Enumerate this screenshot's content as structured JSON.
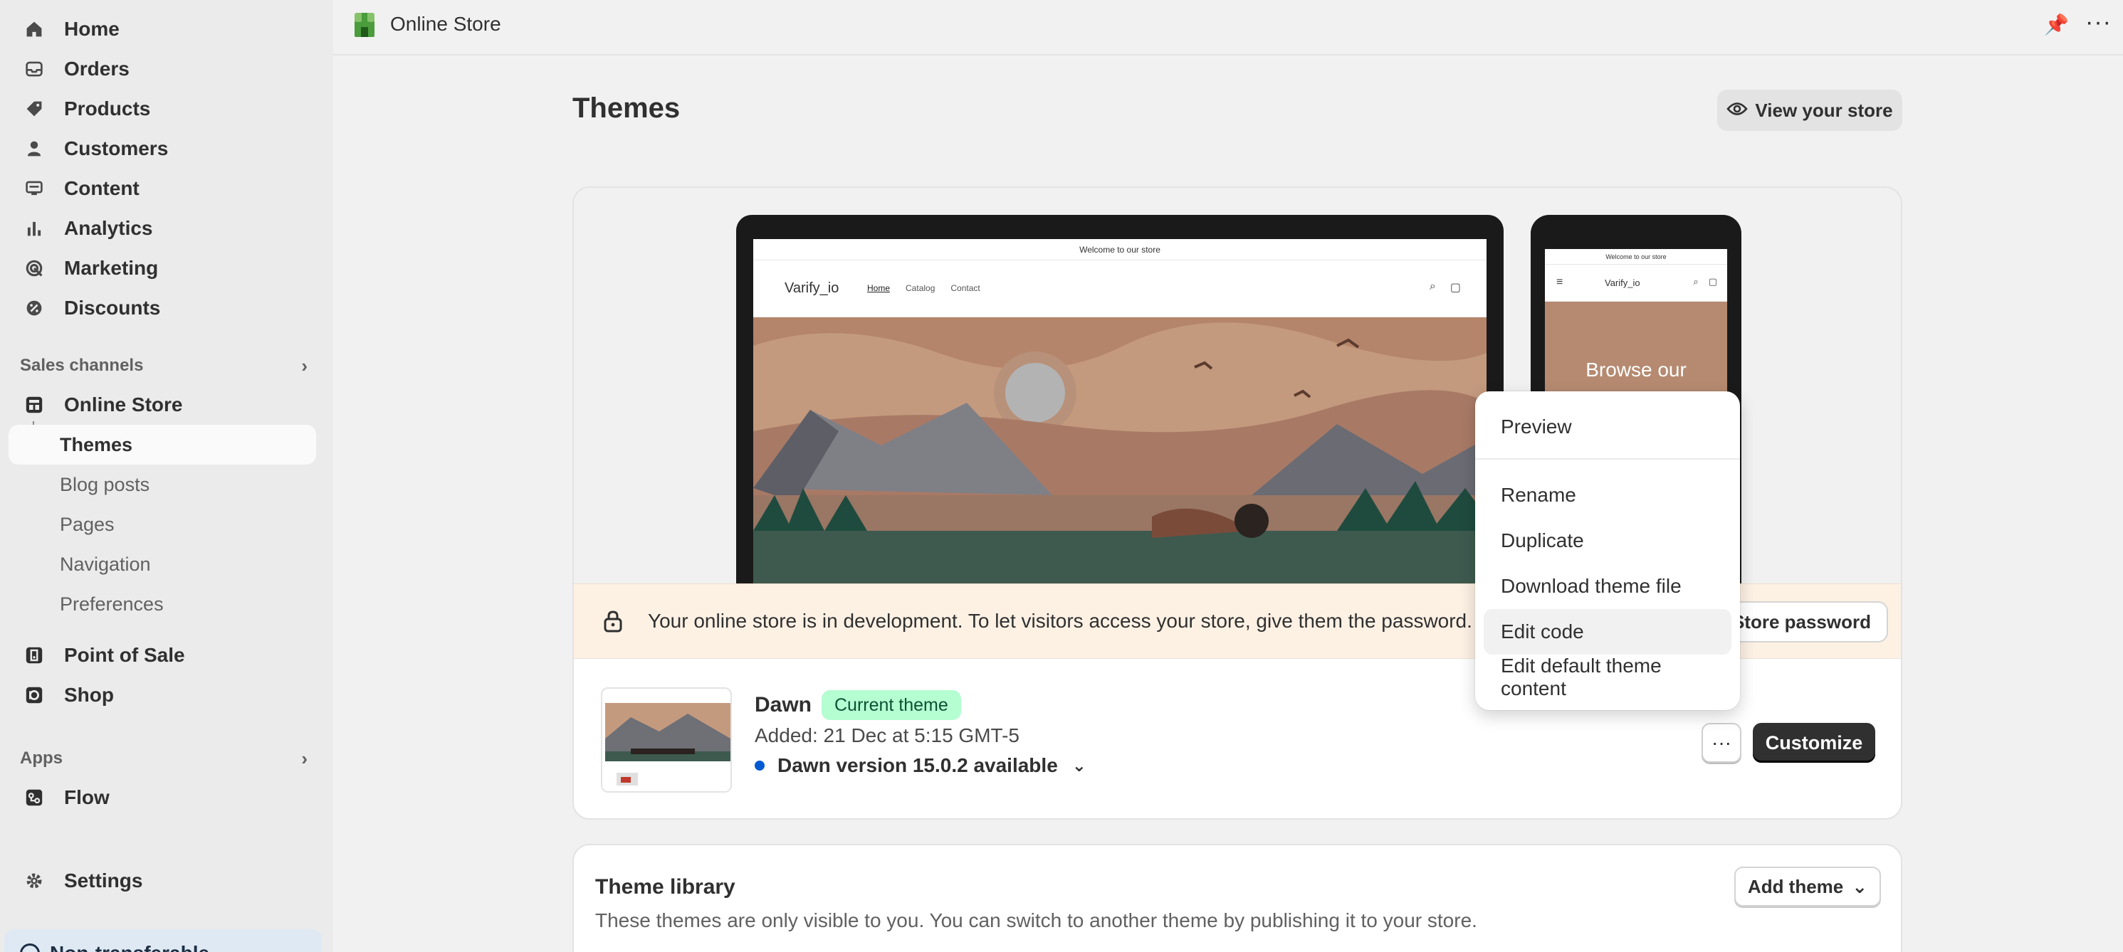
{
  "sidebar": {
    "items": [
      {
        "label": "Home",
        "icon": "home-icon"
      },
      {
        "label": "Orders",
        "icon": "inbox-icon"
      },
      {
        "label": "Products",
        "icon": "tag-icon"
      },
      {
        "label": "Customers",
        "icon": "person-icon"
      },
      {
        "label": "Content",
        "icon": "monitor-icon"
      },
      {
        "label": "Analytics",
        "icon": "bar-chart-icon"
      },
      {
        "label": "Marketing",
        "icon": "target-icon"
      },
      {
        "label": "Discounts",
        "icon": "discount-icon"
      }
    ],
    "sales_channels_label": "Sales channels",
    "online_store_label": "Online Store",
    "online_store_sub": [
      "Themes",
      "Blog posts",
      "Pages",
      "Navigation",
      "Preferences"
    ],
    "pos_label": "Point of Sale",
    "shop_label": "Shop",
    "apps_label": "Apps",
    "flow_label": "Flow",
    "settings_label": "Settings",
    "banner_label": "Non-transferable"
  },
  "topbar": {
    "title": "Online Store"
  },
  "page": {
    "title": "Themes",
    "view_store_label": "View your store"
  },
  "preview": {
    "announcement": "Welcome to our store",
    "brand": "Varify_io",
    "links": [
      "Home",
      "Catalog",
      "Contact"
    ],
    "mobile_hero_text": "Browse our"
  },
  "dev_banner": {
    "message": "Your online store is in development. To let visitors access your store, give them the password.",
    "button_label": "Store password"
  },
  "theme": {
    "name": "Dawn",
    "badge": "Current theme",
    "added": "Added: 21 Dec at 5:15 GMT-5",
    "version": "Dawn version 15.0.2 available",
    "customize_label": "Customize"
  },
  "menu": {
    "items": [
      "Preview",
      "Rename",
      "Duplicate",
      "Download theme file",
      "Edit code",
      "Edit default theme content"
    ],
    "hovered": "Edit code"
  },
  "library": {
    "title": "Theme library",
    "description": "These themes are only visible to you. You can switch to another theme by publishing it to your store.",
    "add_label": "Add theme"
  }
}
